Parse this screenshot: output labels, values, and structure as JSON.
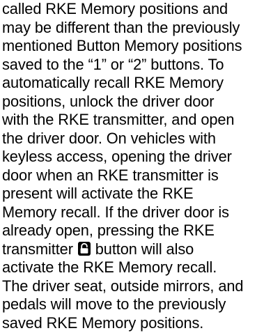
{
  "document": {
    "lines": [
      "called RKE Memory positions and",
      "may be different than the previously",
      "mentioned Button Memory positions",
      "saved to the “1” or “2” buttons. To",
      "automatically recall RKE Memory",
      "positions, unlock the driver door",
      "with the RKE transmitter, and open",
      "the driver door. On vehicles with",
      "keyless access, opening the driver",
      "door when an RKE transmitter is",
      "present will activate the RKE",
      "Memory recall. If the driver door is",
      "already open, pressing the RKE"
    ],
    "line_14_before_icon": "transmitter ",
    "line_14_after_icon": " button will also",
    "lines_after": [
      "activate the RKE Memory recall.",
      "The driver seat, outside mirrors, and",
      "pedals will move to the previously",
      "saved RKE Memory positions."
    ],
    "inline_icon": "unlock-icon"
  }
}
